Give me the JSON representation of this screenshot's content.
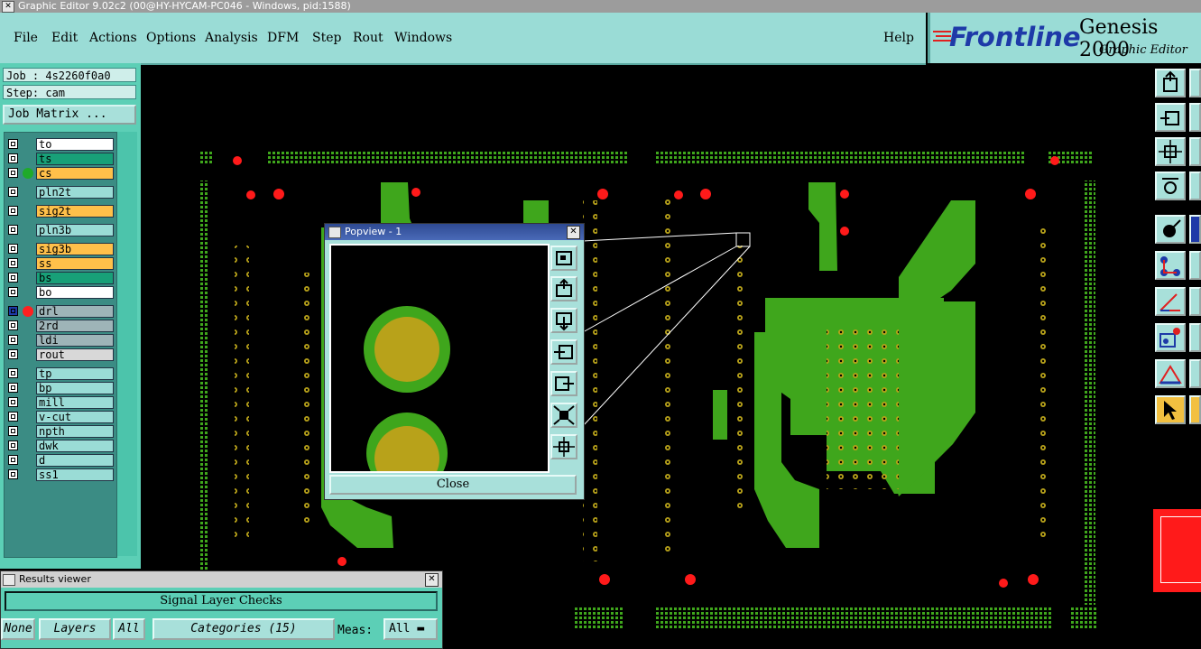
{
  "window": {
    "title": "Graphic Editor 9.02c2 (00@HY-HYCAM-PC046 - Windows, pid:1588)"
  },
  "menu": {
    "items": [
      "File",
      "Edit",
      "Actions",
      "Options",
      "Analysis",
      "DFM",
      "Step",
      "Rout",
      "Windows"
    ],
    "help": "Help"
  },
  "brand": {
    "logo": "Frontline",
    "product": "Genesis 2000",
    "subtitle": "Graphic Editor"
  },
  "info": {
    "job": "Job : 4s2260f0a0",
    "step": "Step: cam",
    "job_matrix": "Job Matrix ..."
  },
  "layers": [
    {
      "name": "to",
      "color": "#ffffff"
    },
    {
      "name": "ts",
      "color": "#18a078"
    },
    {
      "name": "cs",
      "color": "#ffc04a",
      "dot": "#1faa2a"
    },
    {
      "name": "pln2t",
      "color": "#9adcd6"
    },
    {
      "name": "sig2t",
      "color": "#ffc04a"
    },
    {
      "name": "pln3b",
      "color": "#9adcd6"
    },
    {
      "name": "sig3b",
      "color": "#ffc04a"
    },
    {
      "name": "ss",
      "color": "#ffc04a"
    },
    {
      "name": "bs",
      "color": "#18a078"
    },
    {
      "name": "bo",
      "color": "#ffffff"
    },
    {
      "name": "drl",
      "color": "#9eb4b8",
      "dot": "#ff2020",
      "selected": true
    },
    {
      "name": "2rd",
      "color": "#9eb4b8"
    },
    {
      "name": "ldi",
      "color": "#9eb4b8"
    },
    {
      "name": "rout",
      "color": "#d8d8d8"
    },
    {
      "name": "tp",
      "color": "#9adcd6"
    },
    {
      "name": "bp",
      "color": "#9adcd6"
    },
    {
      "name": "mill",
      "color": "#9adcd6"
    },
    {
      "name": "v-cut",
      "color": "#9adcd6"
    },
    {
      "name": "npth",
      "color": "#9adcd6"
    },
    {
      "name": "dwk",
      "color": "#9adcd6"
    },
    {
      "name": "d",
      "color": "#9adcd6"
    },
    {
      "name": "ss1",
      "color": "#9adcd6"
    }
  ],
  "popview": {
    "title": "Popview - 1",
    "close_label": "Close"
  },
  "results": {
    "title": "Results viewer",
    "header": "Signal Layer Checks",
    "none_label": "None",
    "layers_label": "Layers",
    "all_label": "All",
    "categories_label": "Categories (15)",
    "meas_label": "Meas:",
    "meas_value": "All"
  },
  "colors": {
    "copper": "#3fa61c",
    "pad": "#b8a21a",
    "hole": "#ff1a1a",
    "panel": "#9adcd6"
  }
}
